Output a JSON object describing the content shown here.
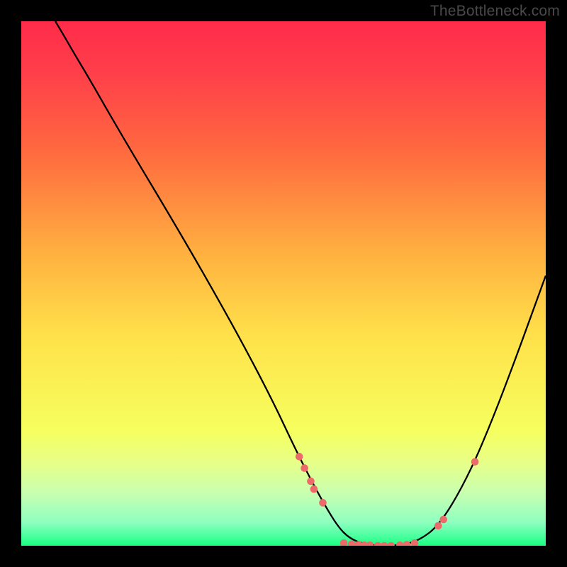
{
  "watermark": "TheBottleneck.com",
  "chart_data": {
    "type": "line",
    "title": "",
    "xlabel": "",
    "ylabel": "",
    "xlim": [
      0,
      100
    ],
    "ylim": [
      0,
      100
    ],
    "gradient_stops": [
      {
        "offset": 0.0,
        "color": "#ff2b4a"
      },
      {
        "offset": 0.1,
        "color": "#ff3f4a"
      },
      {
        "offset": 0.25,
        "color": "#ff6a3f"
      },
      {
        "offset": 0.45,
        "color": "#ffb340"
      },
      {
        "offset": 0.6,
        "color": "#ffe14a"
      },
      {
        "offset": 0.78,
        "color": "#f6ff5e"
      },
      {
        "offset": 0.84,
        "color": "#e8ff87"
      },
      {
        "offset": 0.9,
        "color": "#c8ffb0"
      },
      {
        "offset": 0.955,
        "color": "#8fffc0"
      },
      {
        "offset": 0.985,
        "color": "#40ff9a"
      },
      {
        "offset": 1.0,
        "color": "#1aff7f"
      }
    ],
    "curve": [
      {
        "x": 6.5,
        "y": 100.0
      },
      {
        "x": 8.0,
        "y": 97.5
      },
      {
        "x": 10.0,
        "y": 94.0
      },
      {
        "x": 13.0,
        "y": 89.0
      },
      {
        "x": 17.0,
        "y": 82.0
      },
      {
        "x": 22.0,
        "y": 73.5
      },
      {
        "x": 28.0,
        "y": 63.5
      },
      {
        "x": 35.0,
        "y": 51.5
      },
      {
        "x": 42.0,
        "y": 39.0
      },
      {
        "x": 48.0,
        "y": 27.5
      },
      {
        "x": 52.0,
        "y": 19.0
      },
      {
        "x": 55.0,
        "y": 13.0
      },
      {
        "x": 58.0,
        "y": 7.5
      },
      {
        "x": 60.5,
        "y": 3.5
      },
      {
        "x": 62.5,
        "y": 1.5
      },
      {
        "x": 65.0,
        "y": 0.4
      },
      {
        "x": 68.0,
        "y": 0.0
      },
      {
        "x": 71.0,
        "y": 0.0
      },
      {
        "x": 74.0,
        "y": 0.4
      },
      {
        "x": 76.5,
        "y": 1.5
      },
      {
        "x": 79.0,
        "y": 3.4
      },
      {
        "x": 82.0,
        "y": 7.5
      },
      {
        "x": 86.0,
        "y": 15.0
      },
      {
        "x": 90.0,
        "y": 24.5
      },
      {
        "x": 94.0,
        "y": 35.0
      },
      {
        "x": 98.0,
        "y": 46.0
      },
      {
        "x": 100.0,
        "y": 51.5
      }
    ],
    "markers": [
      {
        "x": 53.0,
        "y": 17.0
      },
      {
        "x": 54.0,
        "y": 14.8
      },
      {
        "x": 55.2,
        "y": 12.3
      },
      {
        "x": 55.8,
        "y": 10.8
      },
      {
        "x": 57.5,
        "y": 8.2
      },
      {
        "x": 61.5,
        "y": 0.5
      },
      {
        "x": 63.0,
        "y": 0.3
      },
      {
        "x": 64.3,
        "y": 0.2
      },
      {
        "x": 65.4,
        "y": 0.1
      },
      {
        "x": 66.5,
        "y": 0.1
      },
      {
        "x": 68.0,
        "y": 0.0
      },
      {
        "x": 69.2,
        "y": 0.0
      },
      {
        "x": 70.5,
        "y": 0.0
      },
      {
        "x": 72.2,
        "y": 0.1
      },
      {
        "x": 73.5,
        "y": 0.2
      },
      {
        "x": 75.0,
        "y": 0.5
      },
      {
        "x": 79.5,
        "y": 3.8
      },
      {
        "x": 80.5,
        "y": 5.0
      },
      {
        "x": 86.5,
        "y": 16.0
      }
    ],
    "marker_color": "#ec6a6a",
    "curve_color": "#000000"
  }
}
